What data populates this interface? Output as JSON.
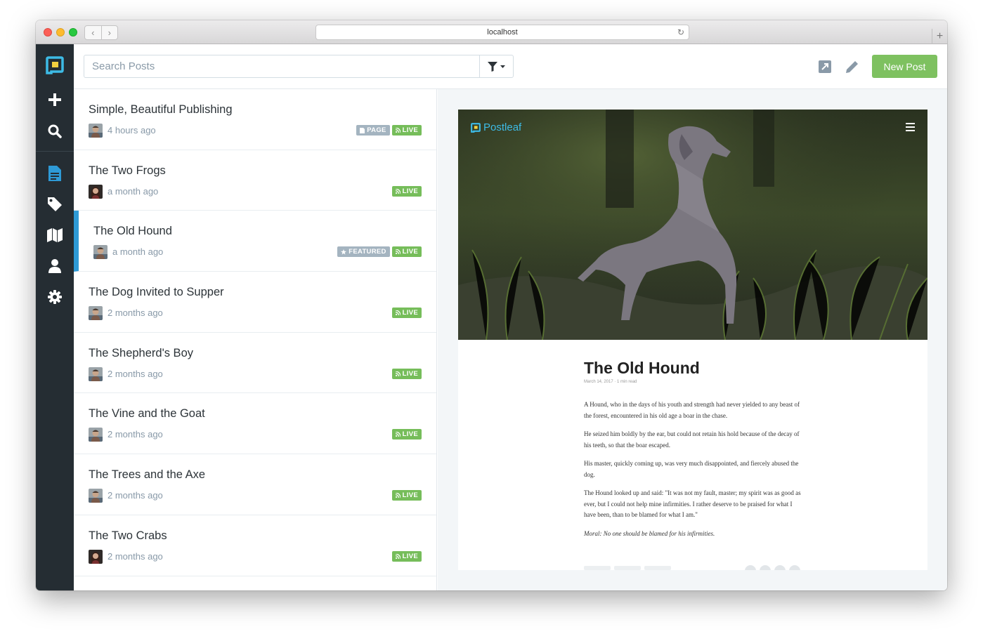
{
  "browser": {
    "url": "localhost"
  },
  "colors": {
    "sidebar_bg": "#252d33",
    "accent_blue": "#2e9ad6",
    "live_green": "#76bd5a",
    "new_post_green": "#7ec160",
    "badge_gray": "#a4b4c0"
  },
  "sidebar": {
    "items": [
      {
        "name": "postleaf-logo",
        "icon": "logo-icon"
      },
      {
        "name": "new-post",
        "icon": "plus-icon"
      },
      {
        "name": "search",
        "icon": "search-icon"
      },
      {
        "name": "posts",
        "icon": "document-icon",
        "active": true
      },
      {
        "name": "tags",
        "icon": "tag-icon"
      },
      {
        "name": "navigation",
        "icon": "map-icon"
      },
      {
        "name": "users",
        "icon": "user-icon"
      },
      {
        "name": "settings",
        "icon": "gear-icon"
      }
    ]
  },
  "toolbar": {
    "search_placeholder": "Search Posts",
    "new_post_label": "New Post"
  },
  "posts": [
    {
      "title": "Simple, Beautiful Publishing",
      "time": "4 hours ago",
      "badges": [
        "PAGE",
        "LIVE"
      ],
      "avatar": "man"
    },
    {
      "title": "The Two Frogs",
      "time": "a month ago",
      "badges": [
        "LIVE"
      ],
      "avatar": "woman"
    },
    {
      "title": "The Old Hound",
      "time": "a month ago",
      "badges": [
        "FEATURED",
        "LIVE"
      ],
      "avatar": "man",
      "active": true
    },
    {
      "title": "The Dog Invited to Supper",
      "time": "2 months ago",
      "badges": [
        "LIVE"
      ],
      "avatar": "man"
    },
    {
      "title": "The Shepherd's Boy",
      "time": "2 months ago",
      "badges": [
        "LIVE"
      ],
      "avatar": "man"
    },
    {
      "title": "The Vine and the Goat",
      "time": "2 months ago",
      "badges": [
        "LIVE"
      ],
      "avatar": "man"
    },
    {
      "title": "The Trees and the Axe",
      "time": "2 months ago",
      "badges": [
        "LIVE"
      ],
      "avatar": "man"
    },
    {
      "title": "The Two Crabs",
      "time": "2 months ago",
      "badges": [
        "LIVE"
      ],
      "avatar": "woman"
    }
  ],
  "preview": {
    "brand": "Postleaf",
    "title": "The Old Hound",
    "meta": "March 14, 2017 · 1 min read",
    "paragraphs": [
      "A Hound, who in the days of his youth and strength had never yielded to any beast of the forest, encountered in his old age a boar in the chase.",
      "He seized him boldly by the ear, but could not retain his hold because of the decay of his teeth, so that the boar escaped.",
      "His master, quickly coming up, was very much disappointed, and fiercely abused the dog.",
      "The Hound looked up and said: \"It was not my fault, master; my spirit was as good as ever, but I could not help mine infirmities. I rather deserve to be praised for what I have been, than to be blamed for what I am.\""
    ],
    "moral": "Moral: No one should be blamed for his infirmities."
  }
}
